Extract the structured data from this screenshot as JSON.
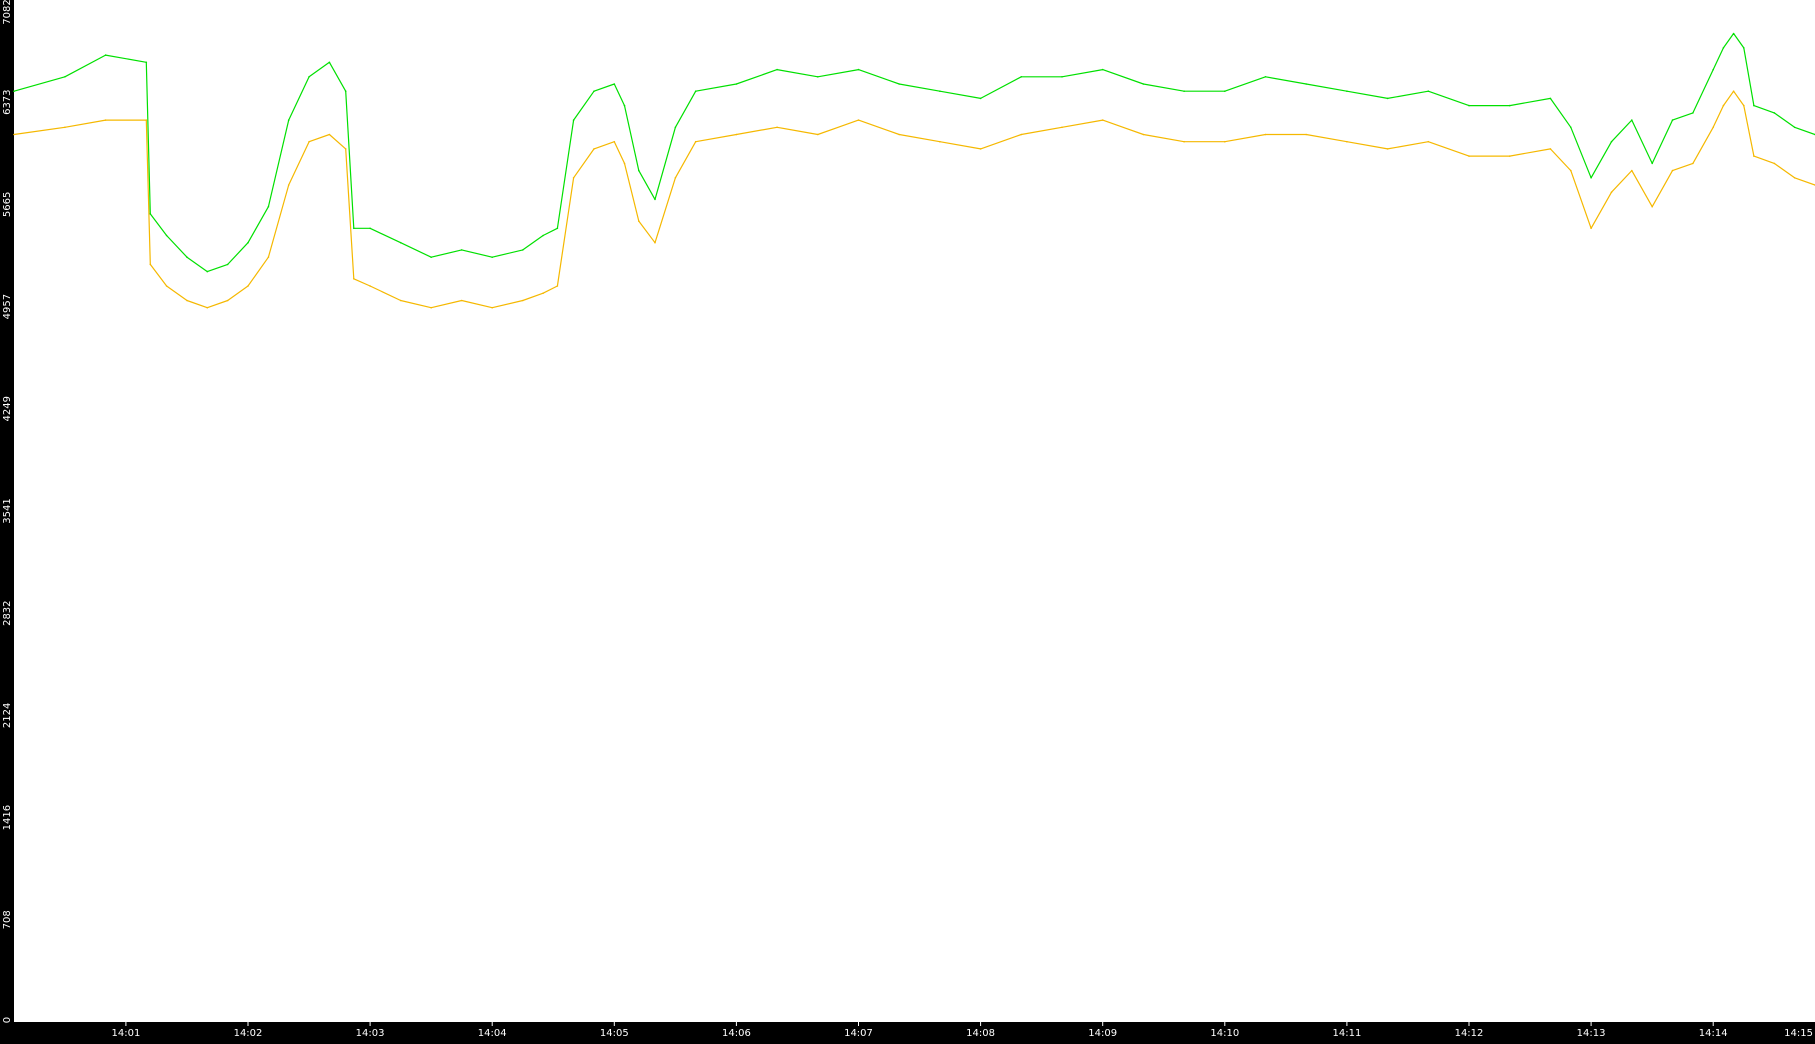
{
  "chart_data": {
    "type": "line",
    "title": "",
    "xlabel": "",
    "ylabel": "",
    "grid": false,
    "legend": "none",
    "colors": {
      "background": "#000000",
      "plot_background": "#ffffff",
      "axis_text": "#ffffff"
    },
    "ylim": [
      0,
      7082
    ],
    "y_ticks": [
      "0",
      "708",
      "1416",
      "2124",
      "2832",
      "3541",
      "4249",
      "4957",
      "5665",
      "6373",
      "7082"
    ],
    "xlim": [
      "14:00:05",
      "14:14:50"
    ],
    "x_ticks": [
      "14:01",
      "14:02",
      "14:03",
      "14:04",
      "14:05",
      "14:06",
      "14:07",
      "14:08",
      "14:09",
      "14:10",
      "14:11",
      "14:12",
      "14:13",
      "14:14",
      "14:15"
    ],
    "x_tick_times": [
      "14:01:00",
      "14:02:00",
      "14:03:00",
      "14:04:00",
      "14:05:00",
      "14:06:00",
      "14:07:00",
      "14:08:00",
      "14:09:00",
      "14:10:00",
      "14:11:00",
      "14:12:00",
      "14:13:00",
      "14:14:00",
      "14:15:00"
    ],
    "series": [
      {
        "color": "#00e000",
        "time": [
          "14:00:05",
          "14:00:30",
          "14:00:50",
          "14:01:10",
          "14:01:12",
          "14:01:20",
          "14:01:30",
          "14:01:40",
          "14:01:50",
          "14:02:00",
          "14:02:10",
          "14:02:20",
          "14:02:30",
          "14:02:40",
          "14:02:48",
          "14:02:52",
          "14:03:00",
          "14:03:15",
          "14:03:30",
          "14:03:45",
          "14:04:00",
          "14:04:15",
          "14:04:25",
          "14:04:32",
          "14:04:40",
          "14:04:50",
          "14:05:00",
          "14:05:05",
          "14:05:12",
          "14:05:20",
          "14:05:30",
          "14:05:40",
          "14:06:00",
          "14:06:20",
          "14:06:40",
          "14:07:00",
          "14:07:20",
          "14:07:40",
          "14:08:00",
          "14:08:20",
          "14:08:40",
          "14:09:00",
          "14:09:20",
          "14:09:40",
          "14:10:00",
          "14:10:20",
          "14:10:40",
          "14:11:00",
          "14:11:20",
          "14:11:40",
          "14:12:00",
          "14:12:20",
          "14:12:40",
          "14:12:50",
          "14:13:00",
          "14:13:10",
          "14:13:20",
          "14:13:30",
          "14:13:40",
          "14:13:50",
          "14:14:00",
          "14:14:05",
          "14:14:10",
          "14:14:15",
          "14:14:20",
          "14:14:30",
          "14:14:40",
          "14:14:50"
        ],
        "values": [
          6450,
          6550,
          6700,
          6650,
          5600,
          5450,
          5300,
          5200,
          5250,
          5400,
          5650,
          6250,
          6550,
          6650,
          6450,
          5500,
          5500,
          5400,
          5300,
          5350,
          5300,
          5350,
          5450,
          5500,
          6250,
          6450,
          6500,
          6350,
          5900,
          5700,
          6200,
          6450,
          6500,
          6600,
          6550,
          6600,
          6500,
          6450,
          6400,
          6550,
          6550,
          6600,
          6500,
          6450,
          6450,
          6550,
          6500,
          6450,
          6400,
          6450,
          6350,
          6350,
          6400,
          6200,
          5850,
          6100,
          6250,
          5950,
          6250,
          6300,
          6600,
          6750,
          6850,
          6750,
          6350,
          6300,
          6200,
          6150
        ]
      },
      {
        "color": "#f5b800",
        "time": [
          "14:00:05",
          "14:00:30",
          "14:00:50",
          "14:01:10",
          "14:01:12",
          "14:01:20",
          "14:01:30",
          "14:01:40",
          "14:01:50",
          "14:02:00",
          "14:02:10",
          "14:02:20",
          "14:02:30",
          "14:02:40",
          "14:02:48",
          "14:02:52",
          "14:03:00",
          "14:03:15",
          "14:03:30",
          "14:03:45",
          "14:04:00",
          "14:04:15",
          "14:04:25",
          "14:04:32",
          "14:04:40",
          "14:04:50",
          "14:05:00",
          "14:05:05",
          "14:05:12",
          "14:05:20",
          "14:05:30",
          "14:05:40",
          "14:06:00",
          "14:06:20",
          "14:06:40",
          "14:07:00",
          "14:07:20",
          "14:07:40",
          "14:08:00",
          "14:08:20",
          "14:08:40",
          "14:09:00",
          "14:09:20",
          "14:09:40",
          "14:10:00",
          "14:10:20",
          "14:10:40",
          "14:11:00",
          "14:11:20",
          "14:11:40",
          "14:12:00",
          "14:12:20",
          "14:12:40",
          "14:12:50",
          "14:13:00",
          "14:13:10",
          "14:13:20",
          "14:13:30",
          "14:13:40",
          "14:13:50",
          "14:14:00",
          "14:14:05",
          "14:14:10",
          "14:14:15",
          "14:14:20",
          "14:14:30",
          "14:14:40",
          "14:14:50"
        ],
        "values": [
          6150,
          6200,
          6250,
          6250,
          5250,
          5100,
          5000,
          4950,
          5000,
          5100,
          5300,
          5800,
          6100,
          6150,
          6050,
          5150,
          5100,
          5000,
          4950,
          5000,
          4950,
          5000,
          5050,
          5100,
          5850,
          6050,
          6100,
          5950,
          5550,
          5400,
          5850,
          6100,
          6150,
          6200,
          6150,
          6250,
          6150,
          6100,
          6050,
          6150,
          6200,
          6250,
          6150,
          6100,
          6100,
          6150,
          6150,
          6100,
          6050,
          6100,
          6000,
          6000,
          6050,
          5900,
          5500,
          5750,
          5900,
          5650,
          5900,
          5950,
          6200,
          6350,
          6450,
          6350,
          6000,
          5950,
          5850,
          5800
        ]
      }
    ]
  }
}
